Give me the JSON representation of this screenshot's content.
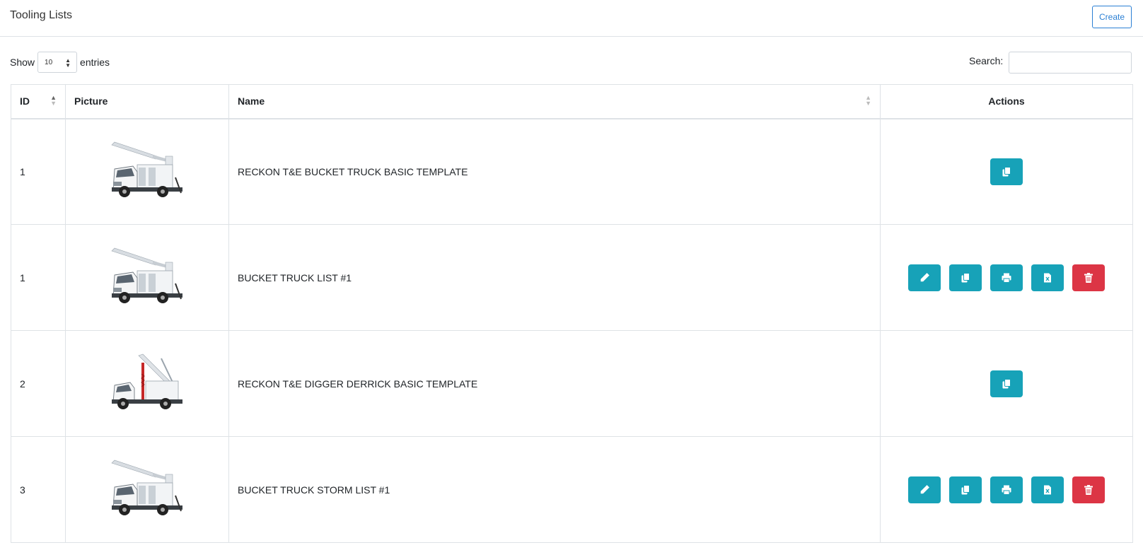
{
  "header": {
    "title": "Tooling Lists",
    "create_label": "Create"
  },
  "length_menu": {
    "show_label": "Show",
    "value": "10",
    "entries_label": "entries"
  },
  "search": {
    "label": "Search:",
    "value": ""
  },
  "table": {
    "columns": [
      "ID",
      "Picture",
      "Name",
      "Actions"
    ],
    "rows": [
      {
        "id": "1",
        "picture": "bucket-truck",
        "name": "RECKON T&E BUCKET TRUCK BASIC TEMPLATE",
        "actions": [
          "copy"
        ]
      },
      {
        "id": "1",
        "picture": "bucket-truck",
        "name": "BUCKET TRUCK LIST #1",
        "actions": [
          "edit",
          "copy",
          "print",
          "excel",
          "delete"
        ]
      },
      {
        "id": "2",
        "picture": "digger-derrick",
        "name": "RECKON T&E DIGGER DERRICK BASIC TEMPLATE",
        "actions": [
          "copy"
        ]
      },
      {
        "id": "3",
        "picture": "bucket-truck",
        "name": "BUCKET TRUCK STORM LIST #1",
        "actions": [
          "edit",
          "copy",
          "print",
          "excel",
          "delete"
        ]
      }
    ]
  },
  "colors": {
    "accent": "#17a2b8",
    "danger": "#dc3545",
    "primary_outline": "#2a7fd4"
  },
  "icons": {
    "edit": "pencil-icon",
    "copy": "copy-icon",
    "print": "print-icon",
    "excel": "excel-file-icon",
    "delete": "trash-icon"
  }
}
